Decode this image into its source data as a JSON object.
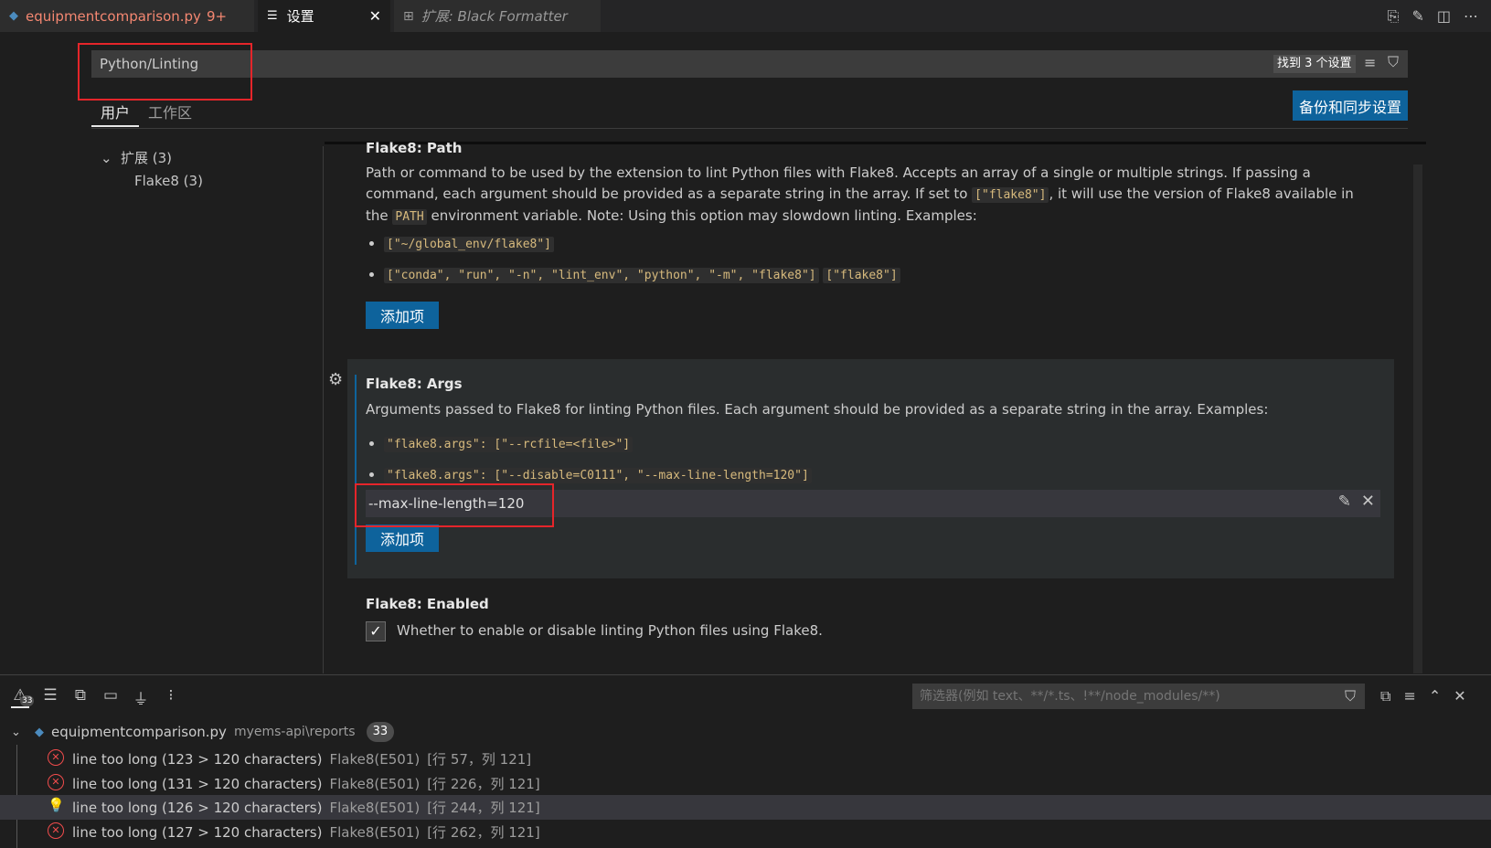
{
  "tabs": {
    "file": {
      "label": "equipmentcomparison.py",
      "badge": "9+"
    },
    "settings": {
      "label": "设置"
    },
    "extension": {
      "label": "扩展: Black Formatter"
    }
  },
  "search": {
    "value": "Python/Linting",
    "result_count": "找到 3 个设置"
  },
  "scope": {
    "user": "用户",
    "workspace": "工作区",
    "sync_button": "备份和同步设置"
  },
  "toc": {
    "extensions": "扩展 (3)",
    "flake8": "Flake8 (3)"
  },
  "settings": {
    "path": {
      "category": "Flake8: ",
      "name": "Path",
      "desc_1": "Path or command to be used by the extension to lint Python files with Flake8. Accepts an array of a single or multiple strings. If passing a command, each argument should be provided as a separate string in the array. If set to ",
      "code_1": "[\"flake8\"]",
      "desc_2": ", it will use the version of Flake8 available in the ",
      "code_2": "PATH",
      "desc_3": " environment variable. Note: Using this option may slowdown linting. Examples:",
      "example_1": "[\"~/global_env/flake8\"]",
      "example_2a": "[\"conda\", \"run\", \"-n\", \"lint_env\", \"python\", \"-m\", \"flake8\"]",
      "example_2b": "[\"flake8\"]",
      "add_button": "添加项"
    },
    "args": {
      "category": "Flake8: ",
      "name": "Args",
      "desc": "Arguments passed to Flake8 for linting Python files. Each argument should be provided as a separate string in the array. Examples:",
      "example_1": "\"flake8.args\": [\"--rcfile=<file>\"]",
      "example_2": "\"flake8.args\": [\"--disable=C0111\", \"--max-line-length=120\"]",
      "item_value": "--max-line-length=120",
      "add_button": "添加项"
    },
    "enabled": {
      "category": "Flake8: ",
      "name": "Enabled",
      "checked": true,
      "check_mark": "✓",
      "desc": "Whether to enable or disable linting Python files using Flake8."
    }
  },
  "panel": {
    "problems_count": "33",
    "filter_placeholder": "筛选器(例如 text、**/*.ts、!**/node_modules/**)",
    "file": {
      "name": "equipmentcomparison.py",
      "path": "myems-api\\reports",
      "count": "33"
    },
    "problems": [
      {
        "message": "line too long (123 > 120 characters)",
        "source": "Flake8(E501)",
        "position": "[行 57，列 121]",
        "kind": "error"
      },
      {
        "message": "line too long (131 > 120 characters)",
        "source": "Flake8(E501)",
        "position": "[行 226，列 121]",
        "kind": "error"
      },
      {
        "message": "line too long (126 > 120 characters)",
        "source": "Flake8(E501)",
        "position": "[行 244，列 121]",
        "kind": "quickfix"
      },
      {
        "message": "line too long (127 > 120 characters)",
        "source": "Flake8(E501)",
        "position": "[行 262，列 121]",
        "kind": "error"
      }
    ]
  },
  "colors": {
    "background": "#1e1e1e",
    "button": "#0e639c",
    "error": "#f14c4c",
    "highlight_box": "#e5252a",
    "code": "#d7ba7d"
  }
}
